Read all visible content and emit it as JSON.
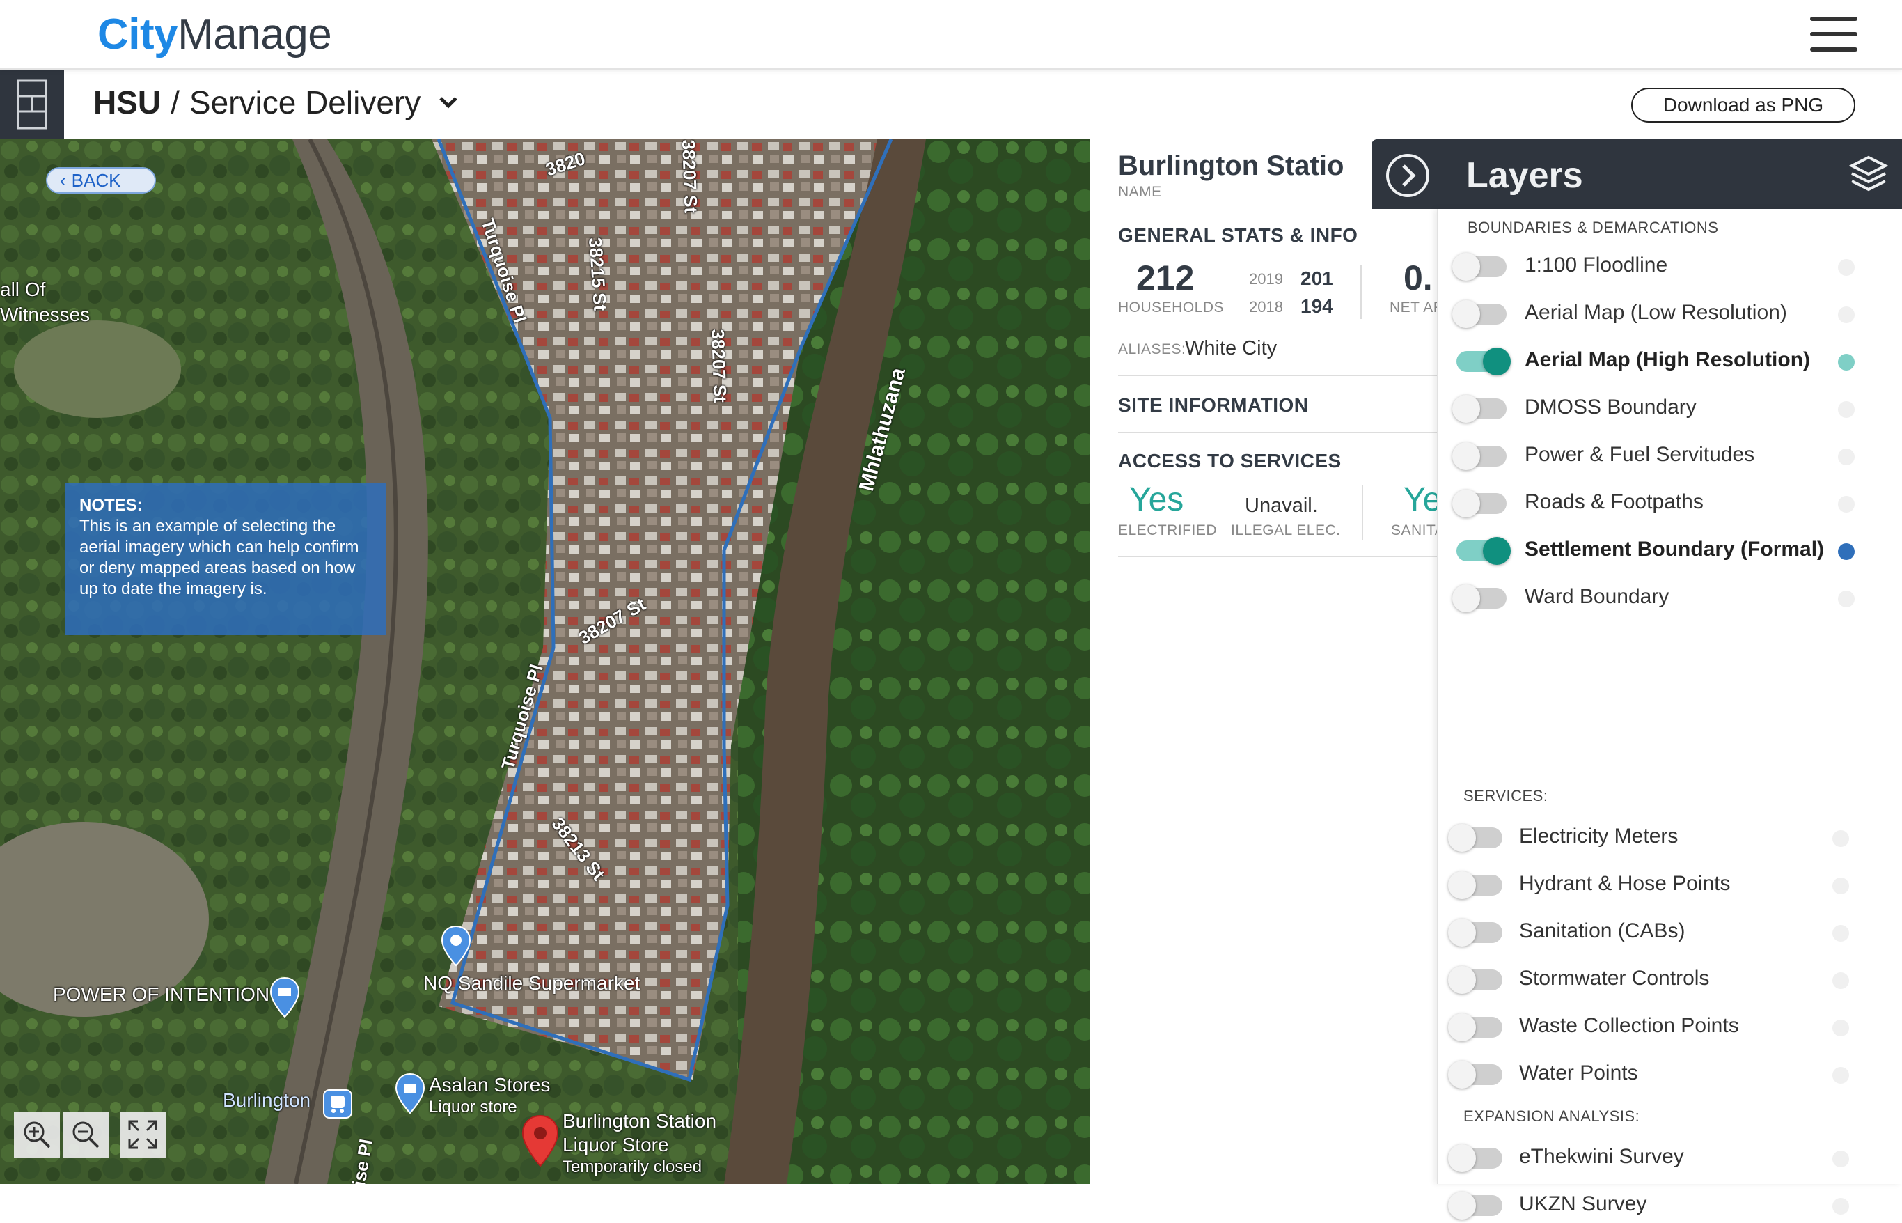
{
  "header": {
    "logo_city": "City",
    "logo_manage": "Manage"
  },
  "subheader": {
    "crumb_root": "HSU",
    "crumb_separator": "/",
    "crumb_page": "Service Delivery",
    "download_label": "Download as PNG"
  },
  "map": {
    "back_label": "BACK",
    "notes_title": "NOTES:",
    "notes_body": "This is an example of selecting the aerial imagery which can help confirm or deny mapped areas based on how up to date the imagery is.",
    "labels": {
      "hall": "all Of",
      "witnesses": "Witnesses",
      "power": "POWER OF INTENTION",
      "supermarket": "NQ Sandile Supermarket",
      "burlington": "Burlington",
      "asalan": "Asalan Stores",
      "asalan_sub": "Liquor store",
      "liquor1": "Burlington Station",
      "liquor2": "Liquor Store",
      "liquor_sub": "Temporarily closed",
      "mhlathuzana": "Mhlathuzana",
      "turquoise_top": "Turquoise Pl",
      "turquoise_mid": "Turquoise Pl",
      "turquoise_bottom": "ise Pl",
      "st_38215": "38215 St",
      "st_38207_top": "38207 St",
      "st_38207_mid": "38207 St",
      "st_38207_low": "38207 St",
      "st_38213": "38213 St",
      "st_3820": "3820"
    }
  },
  "info": {
    "name": "Burlington Statio",
    "name_caption": "NAME",
    "stats_title": "GENERAL STATS & INFO",
    "households": "212",
    "households_caption": "HOUSEHOLDS",
    "year_a": "2019",
    "year_a_value": "201",
    "year_b": "2018",
    "year_b_value": "194",
    "net_value": "0.",
    "net_caption": "NET AR",
    "aliases_caption": "ALIASES:",
    "aliases_value": "White City",
    "site_title": "SITE INFORMATION",
    "access_title": "ACCESS TO SERVICES",
    "electrified_value": "Yes",
    "electrified_caption": "ELECTRIFIED",
    "illegal_value": "Unavail.",
    "illegal_caption": "ILLEGAL ELEC.",
    "sanitation_value": "Ye",
    "sanitation_caption": "SANITA"
  },
  "layers": {
    "title": "Layers",
    "groups": [
      {
        "title": "BOUNDARIES & DEMARCATIONS",
        "items": [
          {
            "label": "1:100 Floodline",
            "on": false,
            "color": "#f0f0f0"
          },
          {
            "label": "Aerial Map (Low Resolution)",
            "on": false,
            "color": "#f0f0f0"
          },
          {
            "label": "Aerial Map (High Resolution)",
            "on": true,
            "color": "#7fcfc6"
          },
          {
            "label": "DMOSS Boundary",
            "on": false,
            "color": "#f0f0f0"
          },
          {
            "label": "Power & Fuel Servitudes",
            "on": false,
            "color": "#f0f0f0"
          },
          {
            "label": "Roads & Footpaths",
            "on": false,
            "color": "#f0f0f0"
          },
          {
            "label": "Settlement Boundary (Formal)",
            "on": true,
            "color": "#2f6fba"
          },
          {
            "label": "Ward Boundary",
            "on": false,
            "color": "#f0f0f0"
          }
        ]
      },
      {
        "title": "SERVICES:",
        "items": [
          {
            "label": "Electricity Meters",
            "on": false,
            "color": "#f0f0f0"
          },
          {
            "label": "Hydrant & Hose Points",
            "on": false,
            "color": "#f0f0f0"
          },
          {
            "label": "Sanitation (CABs)",
            "on": false,
            "color": "#f0f0f0"
          },
          {
            "label": "Stormwater Controls",
            "on": false,
            "color": "#f0f0f0"
          },
          {
            "label": "Waste Collection Points",
            "on": false,
            "color": "#f0f0f0"
          },
          {
            "label": "Water Points",
            "on": false,
            "color": "#f0f0f0"
          }
        ]
      },
      {
        "title": "EXPANSION ANALYSIS:",
        "items": [
          {
            "label": "eThekwini Survey",
            "on": false,
            "color": "#f0f0f0"
          },
          {
            "label": "UKZN Survey",
            "on": false,
            "color": "#f0f0f0"
          }
        ]
      }
    ]
  },
  "colors": {
    "accent": "#1e88e5",
    "toggle_on": "#10907f",
    "boundary": "#2f6fba",
    "dark": "#2f353e"
  },
  "icons": {
    "menu": "hamburger-icon",
    "sidebar": "sidebar-toggle-icon",
    "layers": "layers-stack-icon",
    "collapse": "chevron-right-circle-icon"
  }
}
